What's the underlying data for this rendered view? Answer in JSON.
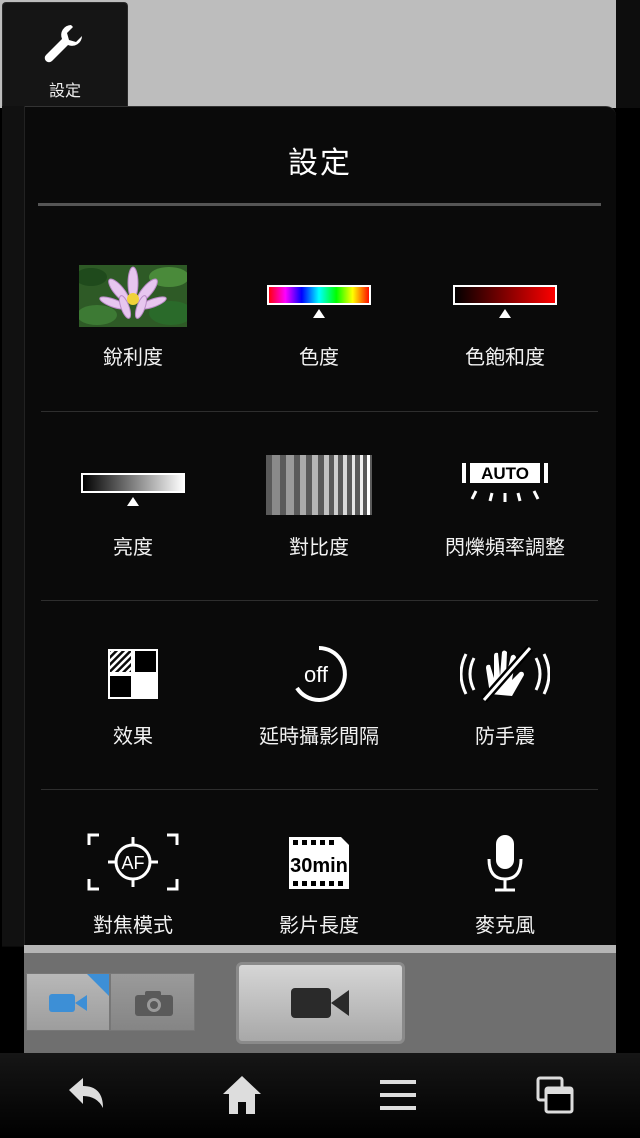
{
  "header": {
    "tab_label": "設定",
    "tab_icon": "wrench-icon"
  },
  "panel": {
    "title": "設定",
    "items": [
      {
        "label": "銳利度",
        "icon": "flower-photo-icon"
      },
      {
        "label": "色度",
        "icon": "hue-slider-icon"
      },
      {
        "label": "色飽和度",
        "icon": "saturation-slider-icon"
      },
      {
        "label": "亮度",
        "icon": "brightness-slider-icon"
      },
      {
        "label": "對比度",
        "icon": "contrast-stripes-icon"
      },
      {
        "label": "閃爍頻率調整",
        "icon": "flicker-auto-icon",
        "icon_text": "AUTO"
      },
      {
        "label": "效果",
        "icon": "effect-squares-icon"
      },
      {
        "label": "延時攝影間隔",
        "icon": "timelapse-off-icon",
        "icon_text": "off"
      },
      {
        "label": "防手震",
        "icon": "stabilization-off-icon"
      },
      {
        "label": "對焦模式",
        "icon": "autofocus-icon",
        "icon_text": "AF"
      },
      {
        "label": "影片長度",
        "icon": "video-length-icon",
        "icon_text": "30min"
      },
      {
        "label": "麥克風",
        "icon": "microphone-icon"
      }
    ]
  },
  "camera": {
    "mode_video": "video-mode-icon",
    "mode_photo": "photo-mode-icon",
    "shutter": "record-button-icon"
  },
  "nav": {
    "back": "back-icon",
    "home": "home-icon",
    "menu": "menu-icon",
    "recents": "recents-icon"
  },
  "colors": {
    "background": "#0a0a0a",
    "preview": "#bdbdbd",
    "text": "#ffffff"
  }
}
